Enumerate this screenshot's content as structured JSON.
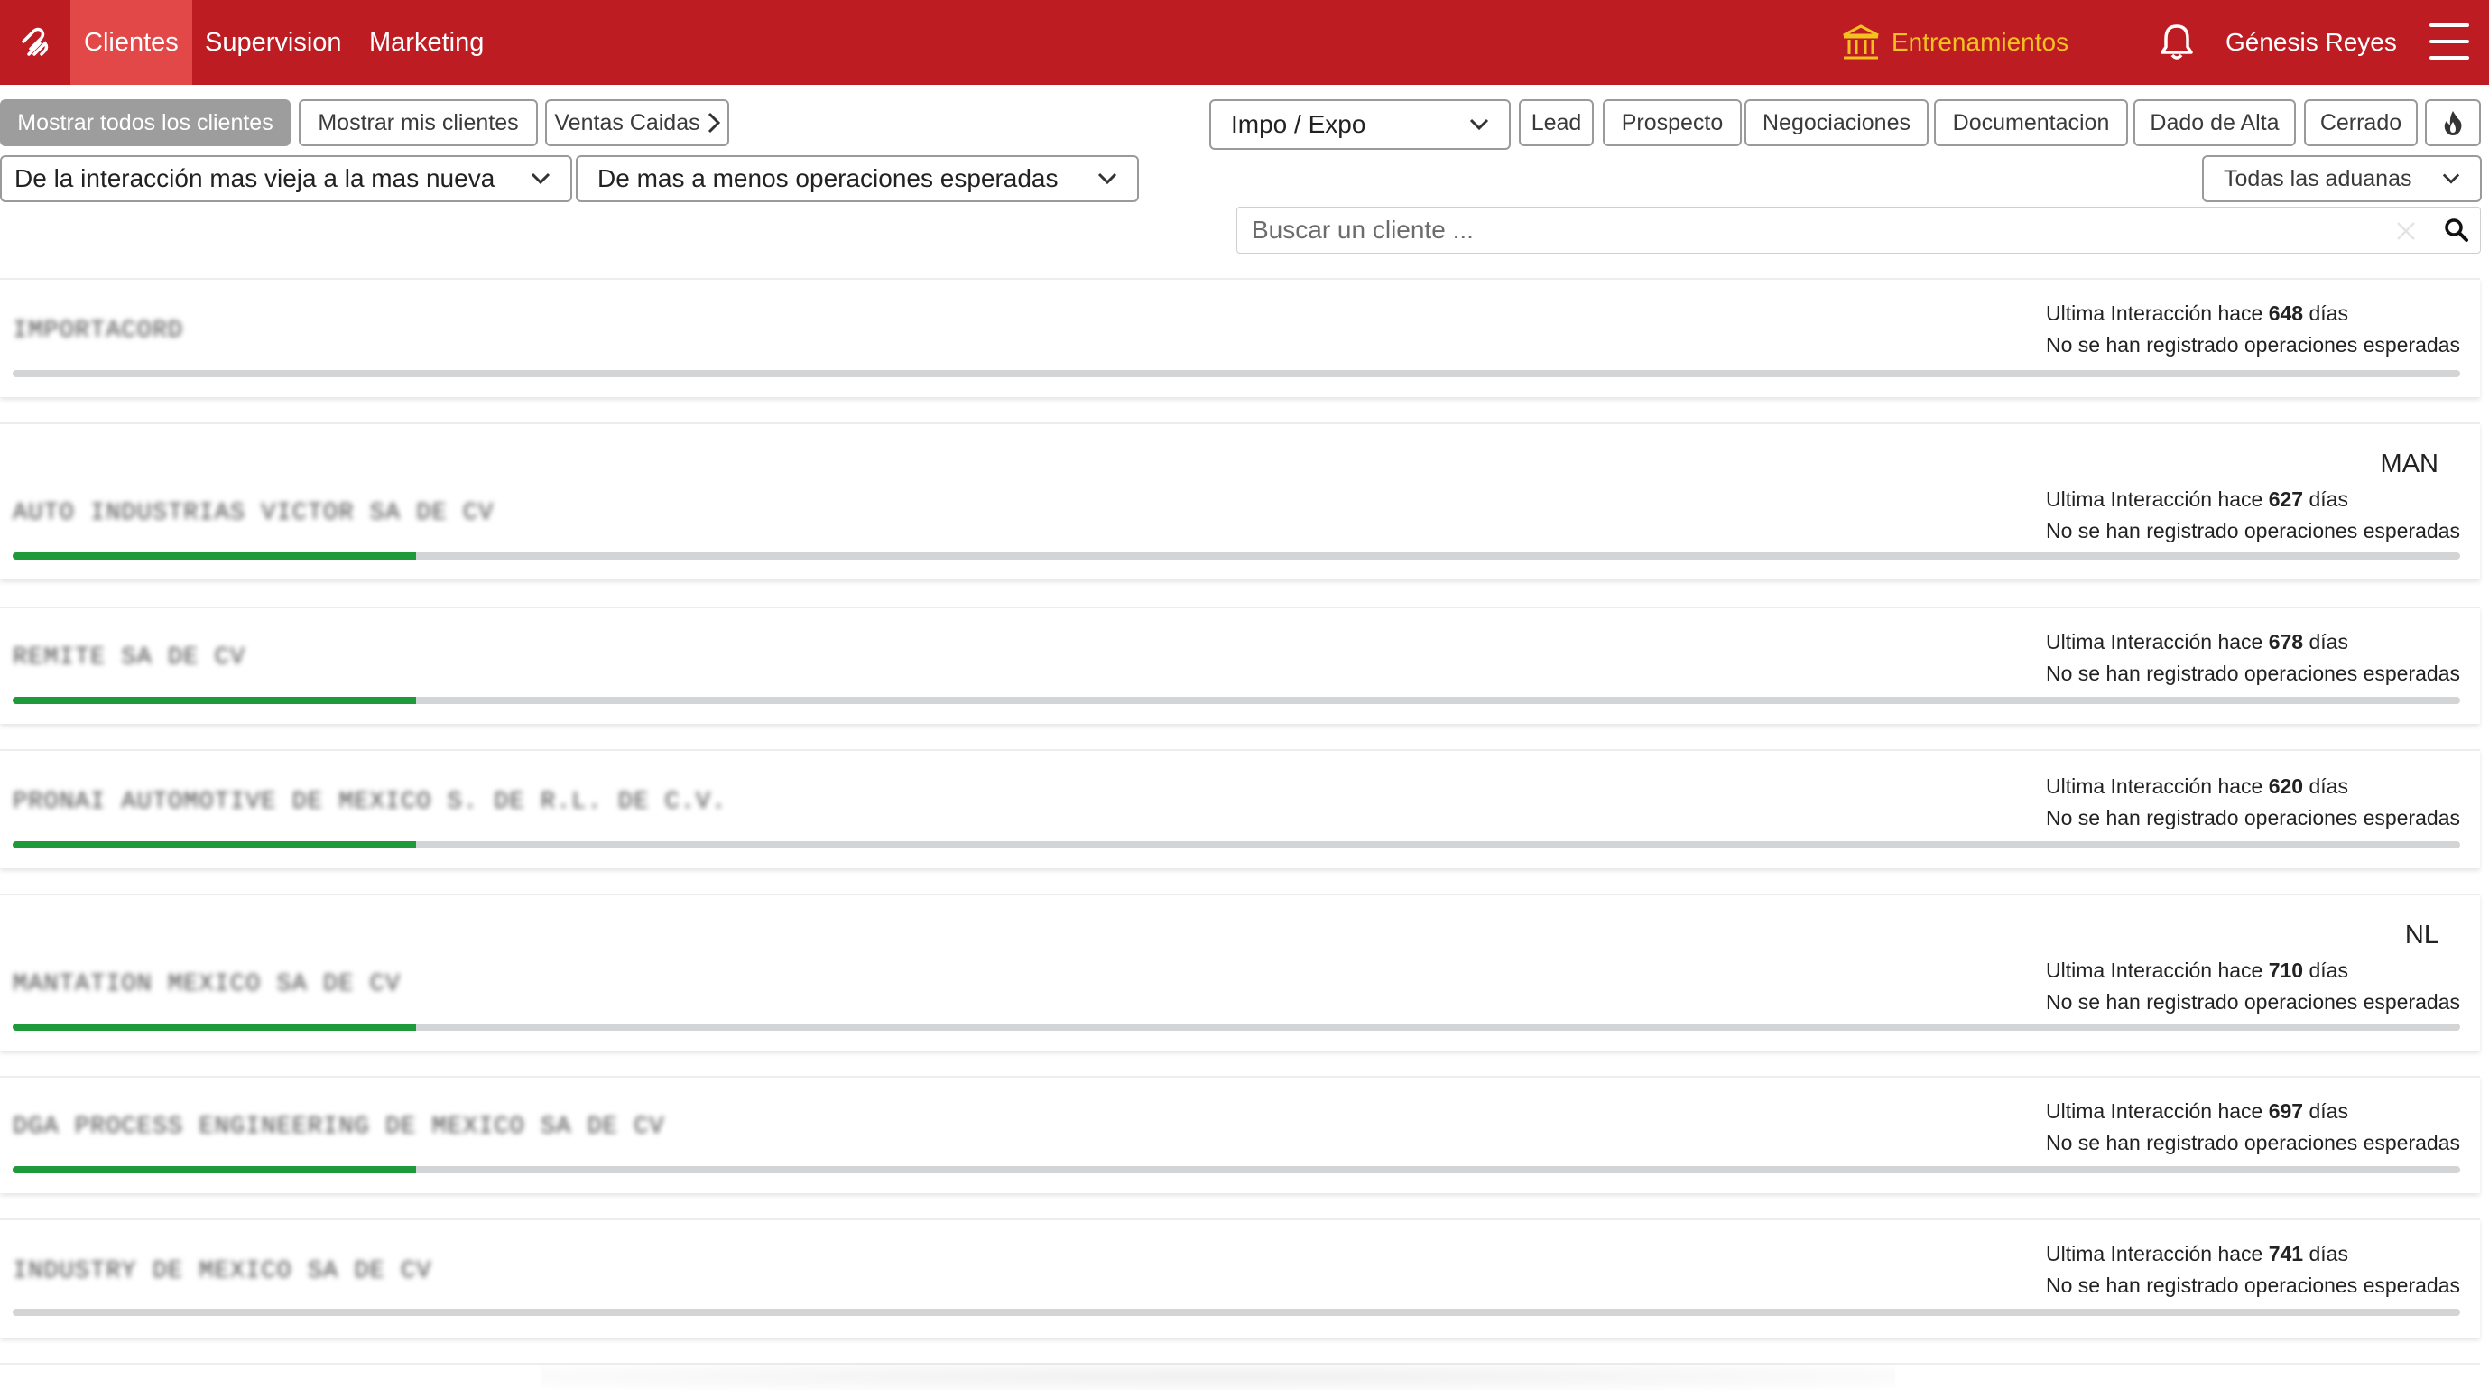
{
  "navbar": {
    "tabs": [
      {
        "label": "Clientes",
        "active": true
      },
      {
        "label": "Supervision",
        "active": false
      },
      {
        "label": "Marketing",
        "active": false
      }
    ],
    "training_label": "Entrenamientos",
    "user_name": "Génesis Reyes"
  },
  "filters": {
    "show_all": "Mostrar todos los clientes",
    "show_mine": "Mostrar mis clientes",
    "lost_sales": "Ventas Caidas",
    "type_select": "Impo / Expo",
    "stages": [
      "Lead",
      "Prospecto",
      "Negociaciones",
      "Documentacion",
      "Dado de Alta",
      "Cerrado"
    ],
    "sort_interaction": "De la interacción mas vieja a la mas nueva",
    "sort_operations": "De mas a menos operaciones esperadas",
    "customs": "Todas las aduanas"
  },
  "search": {
    "placeholder": "Buscar un cliente ..."
  },
  "clients": [
    {
      "name": "IMPORTACORD",
      "region": "",
      "info_prefix": "Ultima Interacción hace",
      "days": "648",
      "info_suffix": "días",
      "ops": "No se han registrado operaciones esperadas",
      "progress": 0
    },
    {
      "name": "AUTO INDUSTRIAS VICTOR SA DE CV",
      "region": "MAN",
      "info_prefix": "Ultima Interacción hace",
      "days": "627",
      "info_suffix": "días",
      "ops": "No se han registrado operaciones esperadas",
      "progress": 0.165
    },
    {
      "name": "REMITE SA DE CV",
      "region": "",
      "info_prefix": "Ultima Interacción hace",
      "days": "678",
      "info_suffix": "días",
      "ops": "No se han registrado operaciones esperadas",
      "progress": 0.165
    },
    {
      "name": "PRONAI AUTOMOTIVE DE MEXICO S. DE R.L. DE C.V.",
      "region": "",
      "info_prefix": "Ultima Interacción hace",
      "days": "620",
      "info_suffix": "días",
      "ops": "No se han registrado operaciones esperadas",
      "progress": 0.165
    },
    {
      "name": "MANTATION MEXICO SA DE CV",
      "region": "NL",
      "info_prefix": "Ultima Interacción hace",
      "days": "710",
      "info_suffix": "días",
      "ops": "No se han registrado operaciones esperadas",
      "progress": 0.165
    },
    {
      "name": "DGA PROCESS ENGINEERING DE MEXICO SA DE CV",
      "region": "",
      "info_prefix": "Ultima Interacción hace",
      "days": "697",
      "info_suffix": "días",
      "ops": "No se han registrado operaciones esperadas",
      "progress": 0.165
    },
    {
      "name": "INDUSTRY DE MEXICO SA DE CV",
      "region": "",
      "info_prefix": "Ultima Interacción hace",
      "days": "741",
      "info_suffix": "días",
      "ops": "No se han registrado operaciones esperadas",
      "progress": 0
    }
  ],
  "colors": {
    "brand": "#bc1c22",
    "active_tab": "#e34848",
    "training": "#f3c220",
    "progress_fill": "#1f9a3a",
    "progress_track": "#d2d4d6"
  }
}
